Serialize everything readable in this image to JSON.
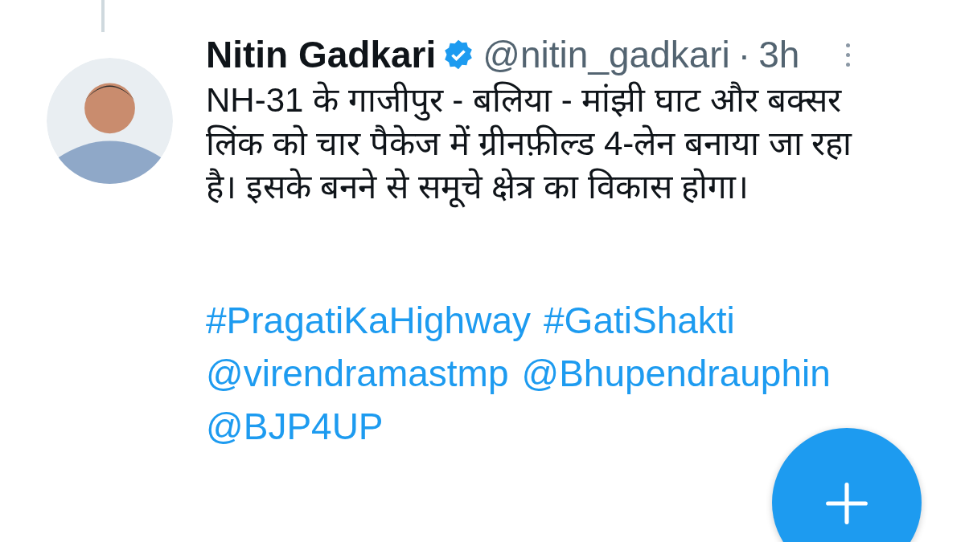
{
  "tweet": {
    "author_name": "Nitin Gadkari",
    "verified": true,
    "handle": "@nitin_gadkari",
    "separator": "·",
    "time": "3h",
    "text": "NH-31 के गाजीपुर - बलिया - मांझी घाट और बक्सर लिंक को चार पैकेज में ग्रीनफ़ील्ड 4-लेन बनाया जा रहा है। इसके बनने से समूचे क्षेत्र का विकास होगा।",
    "links": [
      "#PragatiKaHighway",
      "#GatiShakti",
      "@virendramastmp",
      "@Bhupendrauphin",
      "@BJP4UP"
    ]
  }
}
